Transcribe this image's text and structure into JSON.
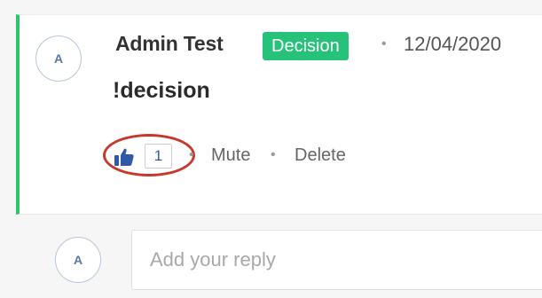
{
  "comment": {
    "avatar_initial": "A",
    "author": "Admin Test",
    "badge": "Decision",
    "separator": "•",
    "date": "12/04/2020",
    "text": "!decision",
    "like_count": "1",
    "actions": {
      "mute": "Mute",
      "delete": "Delete"
    },
    "like_icon": "thumbs-up-icon"
  },
  "reply": {
    "avatar_initial": "A",
    "placeholder": "Add your reply"
  },
  "colors": {
    "accent_green": "#27c27a",
    "highlight_red": "#c9372c",
    "like_blue": "#2f5aa8"
  }
}
